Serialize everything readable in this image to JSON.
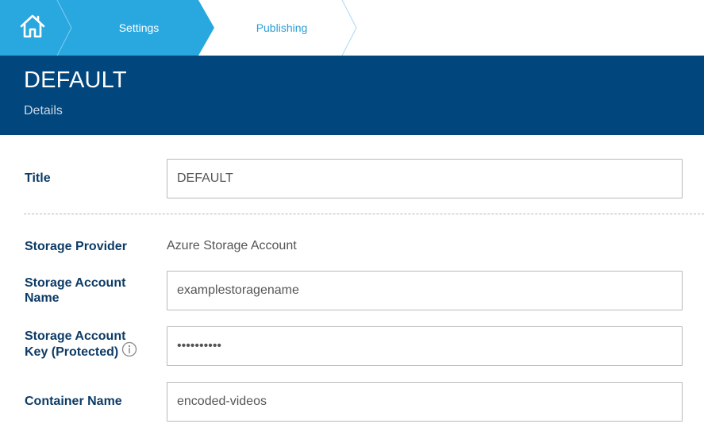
{
  "breadcrumb": {
    "home_icon": "home-icon",
    "items": [
      {
        "label": "Settings",
        "state": "active"
      },
      {
        "label": "Publishing",
        "state": "inactive"
      }
    ],
    "active_color": "#29a8e0",
    "inactive_text_color": "#2a9fd8"
  },
  "header": {
    "title": "DEFAULT",
    "subtitle": "Details",
    "background_color": "#01467c"
  },
  "form": {
    "title": {
      "label": "Title",
      "value": "DEFAULT"
    },
    "storage_provider": {
      "label": "Storage Provider",
      "value": "Azure Storage Account"
    },
    "storage_account_name": {
      "label_line1": "Storage Account",
      "label_line2": "Name",
      "value": "examplestoragename"
    },
    "storage_account_key": {
      "label_line1": "Storage Account",
      "label_line2": "Key (Protected)",
      "value": "••••••••••",
      "info_icon": "info-icon"
    },
    "container_name": {
      "label": "Container Name",
      "value": "encoded-videos"
    }
  }
}
